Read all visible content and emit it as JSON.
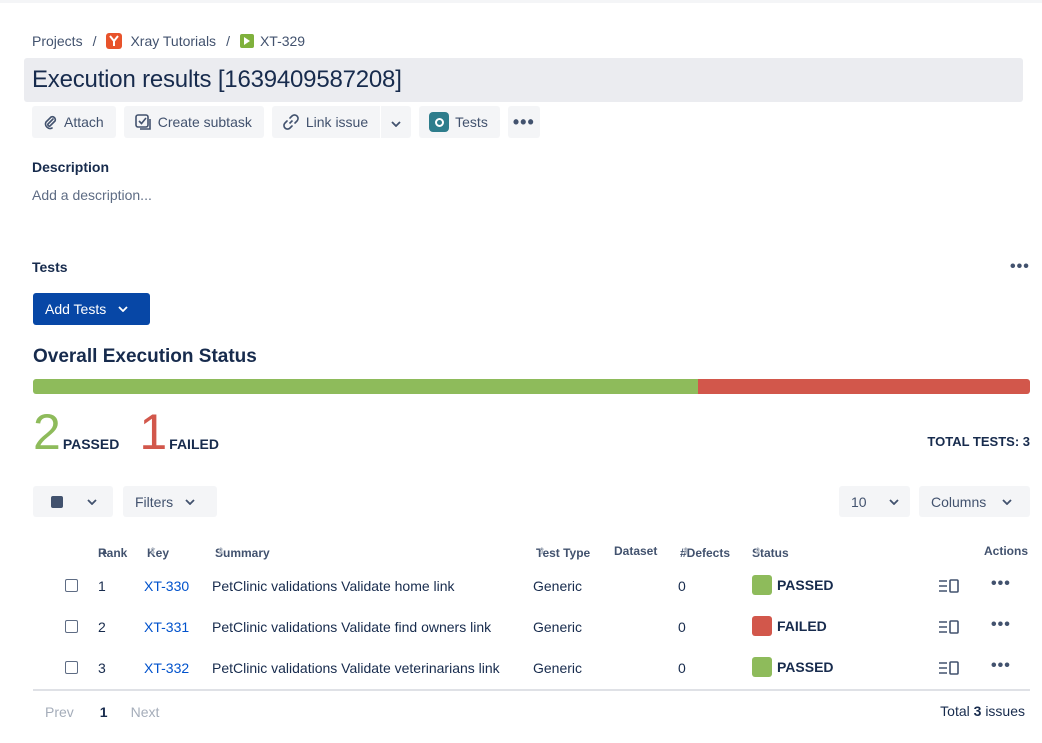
{
  "breadcrumb": {
    "projects": "Projects",
    "separator": "/",
    "project_name": "Xray Tutorials",
    "issue_key": "XT-329"
  },
  "issue": {
    "title": "Execution results [1639409587208]"
  },
  "toolbar": {
    "attach": "Attach",
    "create_subtask": "Create subtask",
    "link_issue": "Link issue",
    "tests": "Tests",
    "more": "•••"
  },
  "description": {
    "heading": "Description",
    "placeholder": "Add a description..."
  },
  "tests_panel": {
    "heading": "Tests",
    "more": "•••",
    "add_tests": "Add Tests",
    "overall_title": "Overall Execution Status",
    "passed_count": "2",
    "passed_label": "PASSED",
    "failed_count": "1",
    "failed_label": "FAILED",
    "passed_fraction": 0.667,
    "total_tests": "TOTAL TESTS: 3",
    "colors": {
      "passed": "#8ebb5b",
      "failed": "#d2574b",
      "primary": "#0747a6",
      "link": "#0052cc"
    }
  },
  "controls": {
    "filters": "Filters",
    "page_size": "10",
    "columns": "Columns"
  },
  "table": {
    "headers": {
      "rank": "Rank",
      "key": "Key",
      "summary": "Summary",
      "test_type": "Test Type",
      "dataset": "Dataset",
      "defects": "#Defects",
      "status": "Status",
      "actions": "Actions"
    },
    "rows": [
      {
        "rank": "1",
        "key": "XT-330",
        "summary": "PetClinic validations Validate home link",
        "test_type": "Generic",
        "defects": "0",
        "status": "PASSED",
        "status_color": "#8ebb5b"
      },
      {
        "rank": "2",
        "key": "XT-331",
        "summary": "PetClinic validations Validate find owners link",
        "test_type": "Generic",
        "defects": "0",
        "status": "FAILED",
        "status_color": "#d2574b"
      },
      {
        "rank": "3",
        "key": "XT-332",
        "summary": "PetClinic validations Validate veterinarians link",
        "test_type": "Generic",
        "defects": "0",
        "status": "PASSED",
        "status_color": "#8ebb5b"
      }
    ]
  },
  "pagination": {
    "prev": "Prev",
    "current": "1",
    "next": "Next",
    "total_prefix": "Total",
    "total_count": "3",
    "total_suffix": "issues"
  }
}
